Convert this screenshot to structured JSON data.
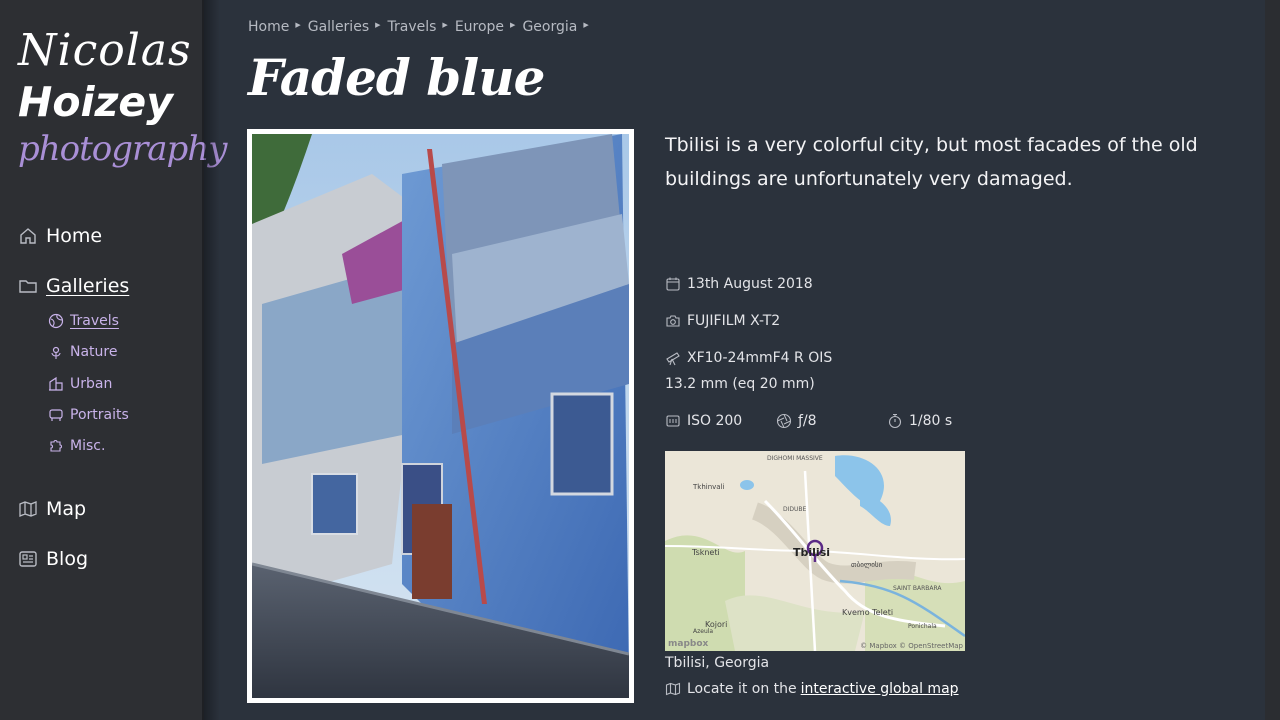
{
  "logo": {
    "line1": "Nicolas",
    "line2": "Hoizey",
    "line3": "photography"
  },
  "nav": {
    "home": "Home",
    "galleries": "Galleries",
    "map": "Map",
    "blog": "Blog",
    "sub": [
      "Travels",
      "Nature",
      "Urban",
      "Portraits",
      "Misc."
    ]
  },
  "breadcrumb": [
    "Home",
    "Galleries",
    "Travels",
    "Europe",
    "Georgia"
  ],
  "page": {
    "title": "Faded blue",
    "description": "Tbilisi is a very colorful city, but most facades of the old buildings are unfortunately very damaged."
  },
  "exif": {
    "date": "13th August 2018",
    "camera": "FUJIFILM X-T2",
    "lens": "XF10-24mmF4 R OIS",
    "focal": "13.2 mm (eq 20 mm)",
    "iso": "ISO 200",
    "aperture": "ƒ/8",
    "shutter": "1/80 s"
  },
  "map": {
    "labels": [
      "DIGHOMI MASSIVE",
      "Tkhinvali",
      "DIDUBE",
      "Tbilisi",
      "Tskneti",
      "თბილისი",
      "SAINT BARBARA",
      "Kojori",
      "Kvemo Teleti",
      "Azeula",
      "Ponichala"
    ],
    "attribution": "© Mapbox © OpenStreetMap",
    "logo": "mapbox"
  },
  "location": {
    "place": "Tbilisi, Georgia",
    "locate_prefix": "Locate it on the",
    "locate_link": "interactive global map"
  },
  "colors": {
    "accent": "#a98fd6",
    "background": "#2b323c",
    "sidebar": "#2d2f33"
  }
}
